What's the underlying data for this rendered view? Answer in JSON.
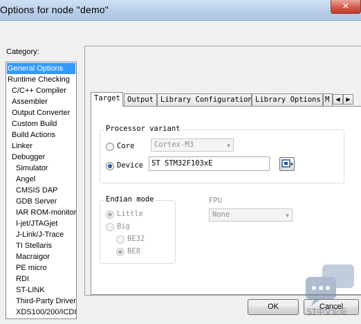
{
  "window": {
    "title": "Options for node \"demo\"",
    "close_symbol": "✕"
  },
  "category": {
    "label": "Category:",
    "items": [
      {
        "label": "General Options",
        "level": 0,
        "selected": true
      },
      {
        "label": "Runtime Checking",
        "level": 0
      },
      {
        "label": "C/C++ Compiler",
        "level": 1
      },
      {
        "label": "Assembler",
        "level": 1
      },
      {
        "label": "Output Converter",
        "level": 1
      },
      {
        "label": "Custom Build",
        "level": 1
      },
      {
        "label": "Build Actions",
        "level": 1
      },
      {
        "label": "Linker",
        "level": 1
      },
      {
        "label": "Debugger",
        "level": 1
      },
      {
        "label": "Simulator",
        "level": 2
      },
      {
        "label": "Angel",
        "level": 2
      },
      {
        "label": "CMSIS DAP",
        "level": 2
      },
      {
        "label": "GDB Server",
        "level": 2
      },
      {
        "label": "IAR ROM-monitor",
        "level": 2
      },
      {
        "label": "I-jet/JTAGjet",
        "level": 2
      },
      {
        "label": "J-Link/J-Trace",
        "level": 2
      },
      {
        "label": "TI Stellaris",
        "level": 2
      },
      {
        "label": "Macraigor",
        "level": 2
      },
      {
        "label": "PE micro",
        "level": 2
      },
      {
        "label": "RDI",
        "level": 2
      },
      {
        "label": "ST-LINK",
        "level": 2
      },
      {
        "label": "Third-Party Driver",
        "level": 2
      },
      {
        "label": "XDS100/200/ICDI",
        "level": 2
      }
    ]
  },
  "tabs": {
    "items": [
      "Target",
      "Output",
      "Library Configuration",
      "Library Options",
      "M"
    ],
    "active": "Target",
    "scroll_left": "◀",
    "scroll_right": "▶"
  },
  "processor_variant": {
    "title": "Processor variant",
    "core_label": "Core",
    "core_value": "Cortex-M3",
    "device_label": "Device",
    "device_value": "ST STM32F103xE",
    "selected": "Device"
  },
  "endian_mode": {
    "title": "Endian mode",
    "little_label": "Little",
    "big_label": "Big",
    "be32_label": "BE32",
    "be8_label": "BE8",
    "selected": "Little",
    "big_sub_selected": "BE8"
  },
  "fpu": {
    "label": "FPU",
    "value": "None"
  },
  "buttons": {
    "ok": "OK",
    "cancel": "Cancel"
  },
  "watermark": {
    "text": "ST中文论坛"
  },
  "icons": {
    "combo_arrow": "chevron-down-icon",
    "browse": "device-browse-icon",
    "watermark": "chat-bubble-icon"
  }
}
